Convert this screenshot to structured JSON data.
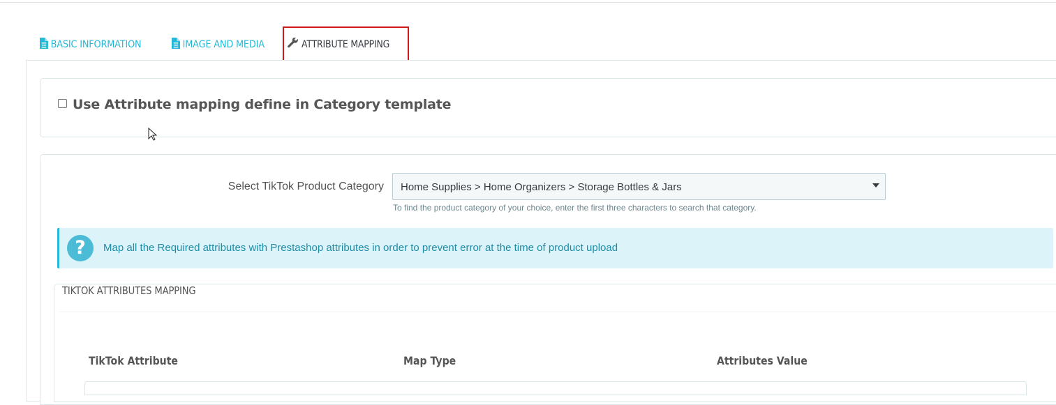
{
  "tabs": {
    "basic": "BASIC INFORMATION",
    "image": "IMAGE AND MEDIA",
    "attribute": "ATTRIBUTE MAPPING"
  },
  "category_template": {
    "checkbox_label": "Use Attribute mapping define in Category template",
    "checked": false
  },
  "category_select": {
    "label": "Select TikTok Product Category",
    "value": "Home Supplies > Home Organizers > Storage Bottles & Jars",
    "help": "To find the product category of your choice, enter the first three characters to search that category."
  },
  "alert": {
    "message": "Map all the Required attributes with Prestashop attributes in order to prevent error at the time of product upload"
  },
  "mapping": {
    "title": "TIKTOK ATTRIBUTES MAPPING",
    "columns": [
      "TikTok Attribute",
      "Map Type",
      "Attributes Value"
    ]
  },
  "icons": {
    "tab_basic": "file-icon",
    "tab_image": "file-icon",
    "tab_attribute": "wrench-icon",
    "alert": "question-circle-icon"
  },
  "colors": {
    "accent": "#25b9d7",
    "active_tab_border": "#d0191f",
    "alert_bg": "#dcf4f9"
  }
}
